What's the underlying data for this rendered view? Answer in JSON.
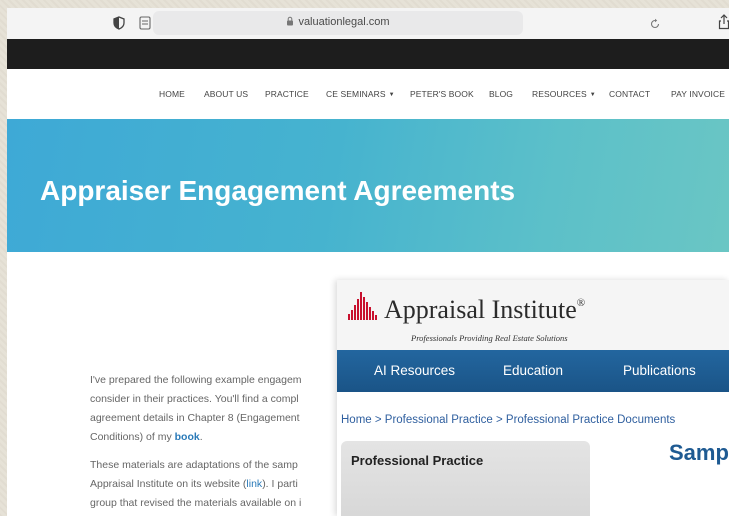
{
  "browser": {
    "url": "valuationlegal.com"
  },
  "nav": {
    "items": [
      {
        "label": "HOME"
      },
      {
        "label": "ABOUT US"
      },
      {
        "label": "PRACTICE"
      },
      {
        "label": "CE SEMINARS"
      },
      {
        "label": "PETER'S BOOK"
      },
      {
        "label": "BLOG"
      },
      {
        "label": "RESOURCES"
      },
      {
        "label": "CONTACT"
      },
      {
        "label": "PAY INVOICE"
      }
    ]
  },
  "hero": {
    "title": "Appraiser Engagement Agreements"
  },
  "content": {
    "p1_line1": "I've prepared the following example engagem",
    "p1_line2": "consider in their practices. You'll find a compl",
    "p1_line3": "agreement details in Chapter 8 (Engagement",
    "p1_line4_pre": "Conditions) of my ",
    "p1_line4_link": "book",
    "p1_line4_post": ".",
    "p2_line1": "These materials are adaptations of the samp",
    "p2_line2_pre": "Appraisal Institute on its website (",
    "p2_line2_link": "link",
    "p2_line2_post": "). I parti",
    "p2_line3": "group that revised the materials available on i"
  },
  "ai": {
    "logo": "Appraisal Institute",
    "logo_mark": "®",
    "tagline": "Professionals Providing Real Estate Solutions",
    "nav": [
      {
        "label": "AI Resources"
      },
      {
        "label": "Education"
      },
      {
        "label": "Publications"
      }
    ],
    "breadcrumb": "Home > Professional Practice > Professional Practice Documents",
    "side_title": "Professional Practice",
    "heading": "Samp",
    "accent": "#c8102e",
    "nav_color": "#1f5e96"
  }
}
